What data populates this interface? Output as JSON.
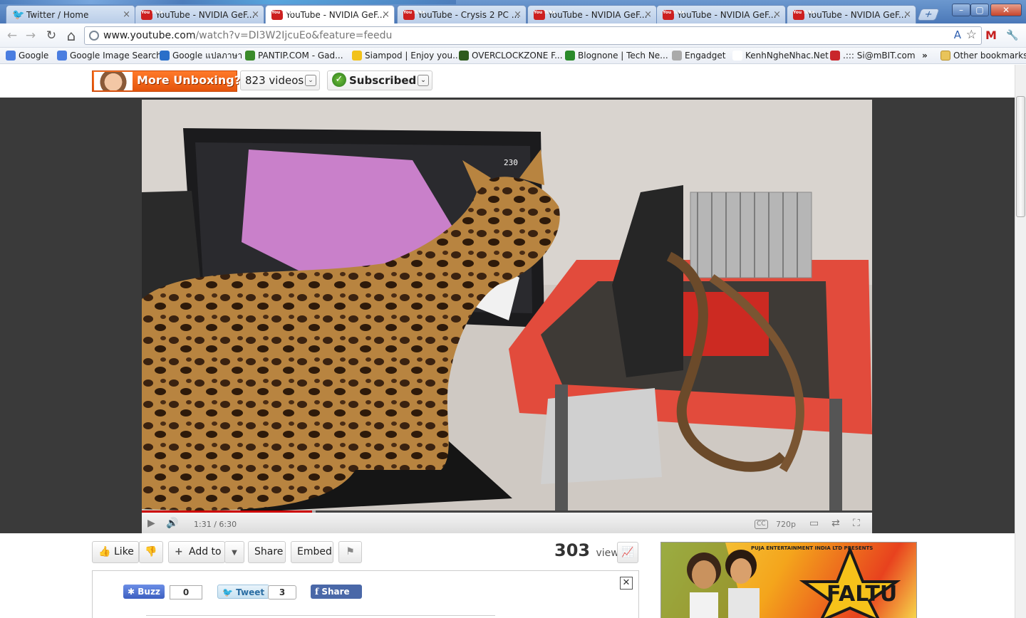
{
  "browser": {
    "tabs": [
      {
        "title": "Twitter / Home",
        "icon": "twitter-icon",
        "active": false
      },
      {
        "title": "YouTube - NVIDIA GeF...",
        "icon": "youtube-icon",
        "active": false
      },
      {
        "title": "YouTube - NVIDIA GeF...",
        "icon": "youtube-icon",
        "active": true
      },
      {
        "title": "YouTube - Crysis 2 PC ...",
        "icon": "youtube-icon",
        "active": false
      },
      {
        "title": "YouTube - NVIDIA GeF...",
        "icon": "youtube-icon",
        "active": false
      },
      {
        "title": "YouTube - NVIDIA GeF...",
        "icon": "youtube-icon",
        "active": false
      },
      {
        "title": "YouTube - NVIDIA GeF...",
        "icon": "youtube-icon",
        "active": false
      }
    ],
    "favicon_text": "You Tube",
    "new_tab": "+",
    "window": {
      "minimize": "–",
      "maximize": "▢",
      "close": "✕"
    },
    "nav": {
      "back": "←",
      "forward": "→",
      "reload": "↻",
      "home": "⌂"
    },
    "url": {
      "host": "www.youtube.com",
      "rest": "/watch?v=DI3W2IjcuEo&feature=feedu"
    },
    "omnibox_icons": {
      "translate": "A",
      "star": "☆"
    },
    "right_icons": {
      "gmail": "M",
      "wrench": "🔧"
    },
    "bookmarks": [
      {
        "label": "Google",
        "icon": "google-icon",
        "color": "#4a7de0"
      },
      {
        "label": "Google Image Search",
        "icon": "google-icon",
        "color": "#4a7de0"
      },
      {
        "label": "Google แปลภาษา",
        "icon": "translate-icon",
        "color": "#2a6fc9"
      },
      {
        "label": "PANTIP.COM - Gad...",
        "icon": "cactus-icon",
        "color": "#3a8a2a"
      },
      {
        "label": "Siampod | Enjoy you...",
        "icon": "siampod-icon",
        "color": "#f2c21a"
      },
      {
        "label": "OVERCLOCKZONE F...",
        "icon": "diamond-icon",
        "color": "#2d5a1d"
      },
      {
        "label": "Blognone | Tech Ne...",
        "icon": "bn-icon",
        "color": "#2a8a2a"
      },
      {
        "label": "Engadget",
        "icon": "rss-icon",
        "color": "#aaaaaa"
      },
      {
        "label": "KenhNgheNhac.Net",
        "icon": "blank-icon",
        "color": "#ffffff"
      },
      {
        "label": ".::: Si@mBIT.com",
        "icon": "thai-flag-icon",
        "color": "#c9262b"
      }
    ],
    "bookmarks_overflow": "»",
    "other_bookmarks": "Other bookmarks"
  },
  "channel": {
    "banner_text": "More Unboxing?",
    "videos_count": "823 videos",
    "subscribed": "Subscribed",
    "caret": "⌄"
  },
  "player": {
    "hud_fps": "230",
    "time": "1:31 / 6:30",
    "quality": "720p",
    "progress": 0.233,
    "buffered": 0.238,
    "cc": "CC"
  },
  "actions": {
    "like": "Like",
    "add_to": "Add to",
    "share": "Share",
    "embed": "Embed"
  },
  "views": {
    "count": "303",
    "label": "views"
  },
  "share_panel": {
    "buzz": "Buzz",
    "buzz_count": "0",
    "tweet": "Tweet",
    "tweet_count": "3",
    "fb_share": "Share",
    "close": "✕"
  },
  "ad": {
    "presents": "PUJA ENTERTAINMENT INDIA LTD PRESENTS",
    "title": "FALTU"
  }
}
